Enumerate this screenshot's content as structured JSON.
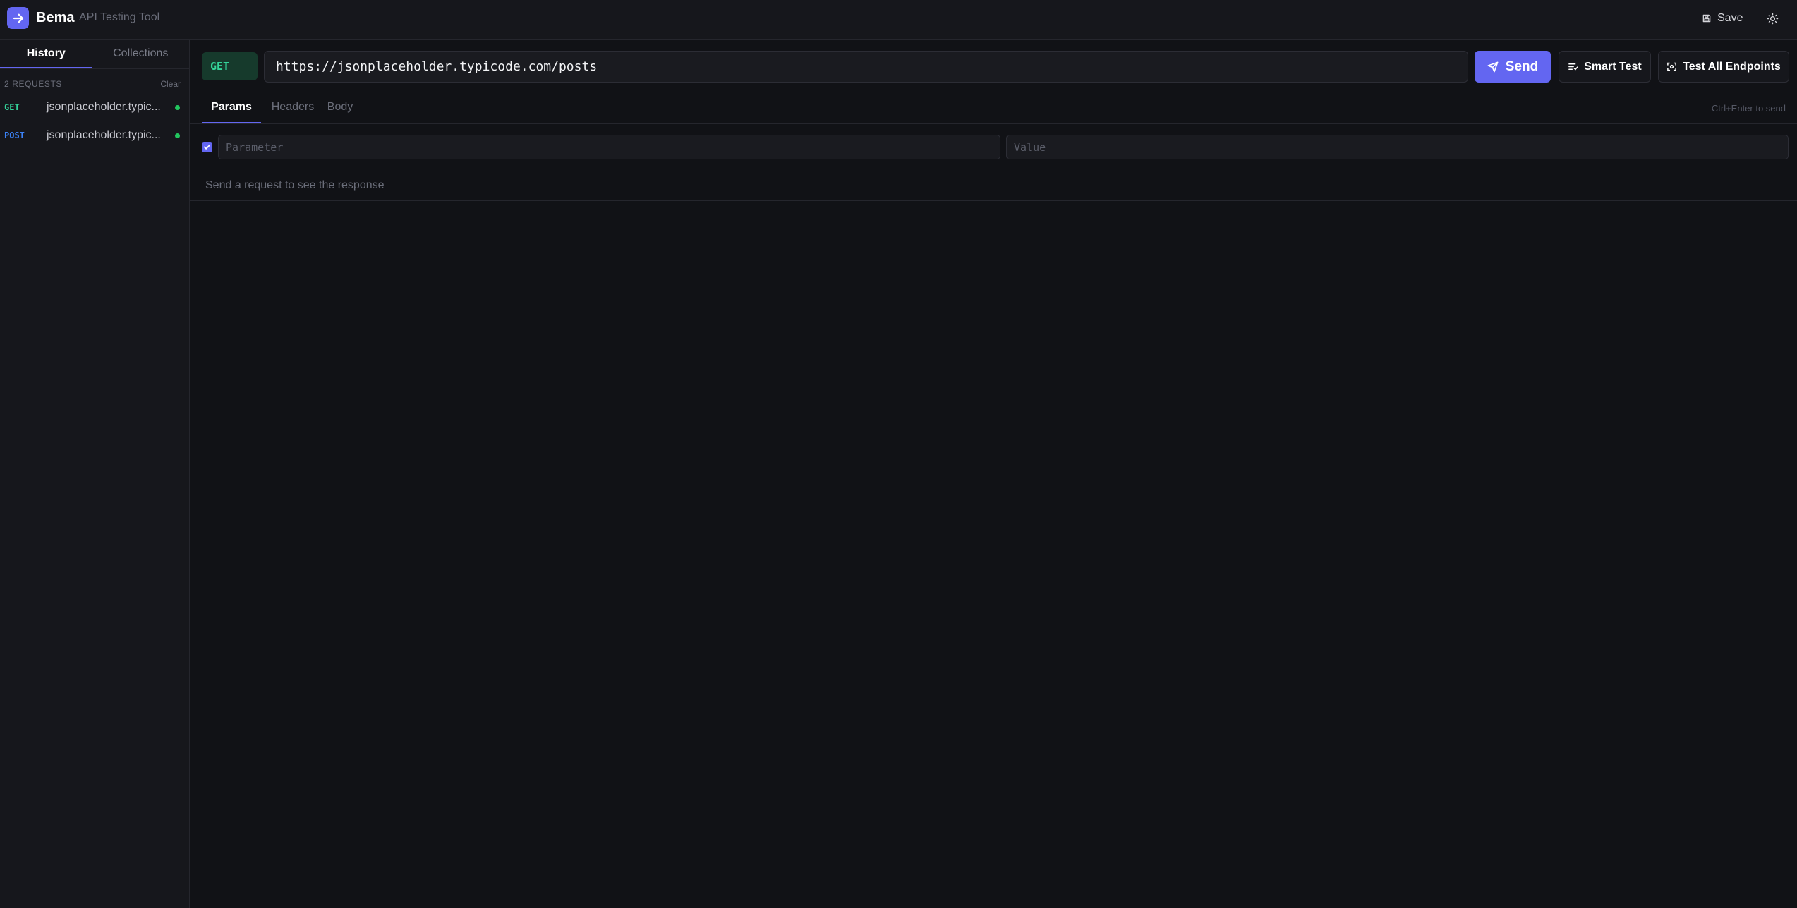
{
  "app": {
    "name": "Bema",
    "subtitle": "API Testing Tool",
    "save_label": "Save"
  },
  "sidebar": {
    "tabs": [
      {
        "label": "History",
        "active": true
      },
      {
        "label": "Collections",
        "active": false
      }
    ],
    "count_label": "2 REQUESTS",
    "clear_label": "Clear",
    "history": [
      {
        "method": "GET",
        "url": "jsonplaceholder.typic...",
        "method_color": "#22c55e",
        "status_color": "#22c55e"
      },
      {
        "method": "POST",
        "url": "jsonplaceholder.typic...",
        "method_color": "#3b82f6",
        "status_color": "#22c55e"
      }
    ]
  },
  "request": {
    "method": "GET",
    "url": "https://jsonplaceholder.typicode.com/posts",
    "send_label": "Send",
    "smart_test_label": "Smart Test",
    "test_all_label": "Test All Endpoints",
    "tabs": [
      {
        "label": "Params",
        "active": true
      },
      {
        "label": "Headers",
        "active": false
      },
      {
        "label": "Body",
        "active": false
      }
    ],
    "shortcut_hint": "Ctrl+Enter to send",
    "params": [
      {
        "enabled": true,
        "key_placeholder": "Parameter",
        "value_placeholder": "Value",
        "key": "",
        "value": ""
      }
    ]
  },
  "response": {
    "empty_message": "Send a request to see the response"
  },
  "colors": {
    "accent": "#6366f1",
    "background": "#111216",
    "panel": "#16171c",
    "get_method": "#34d399",
    "post_method": "#3b82f6"
  },
  "icons": {
    "logo": "arrow-right-icon",
    "save": "floppy-disk-icon",
    "theme": "sun-icon",
    "send": "paper-plane-icon",
    "smart_test": "list-filter-icon",
    "test_all": "scan-icon",
    "check": "check-icon"
  }
}
